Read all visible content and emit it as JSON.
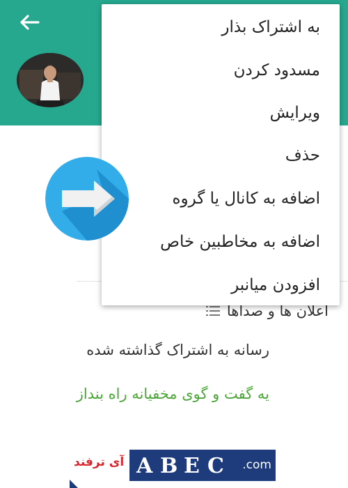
{
  "header": {
    "back_icon": "arrow-left-icon",
    "avatar_icon": "profile-photo",
    "color": "#26a88f"
  },
  "menu": {
    "items": [
      {
        "label": "به اشتراک بذار"
      },
      {
        "label": "مسدود کردن"
      },
      {
        "label": "ویرایش"
      },
      {
        "label": "حذف"
      },
      {
        "label": "اضافه به کانال یا گروه"
      },
      {
        "label": "اضافه به مخاطبین خاص"
      },
      {
        "label": "افزودن میانبر"
      }
    ]
  },
  "content": {
    "notifications_label": "اعلان ها و صداها",
    "notifications_icon": "list-icon",
    "shared_media_label": "رسانه به اشتراک گذاشته شده",
    "secret_chat_label": "یه گفت و گوی مخفیانه راه بنداز",
    "secret_chat_color": "#4aa637"
  },
  "overlay": {
    "arrow_icon": "arrow-right-icon",
    "color": "#2aa8e8"
  },
  "footer": {
    "brand_label": "آی ترفند",
    "domain_label": ".com",
    "color": "#1e3c7b"
  }
}
